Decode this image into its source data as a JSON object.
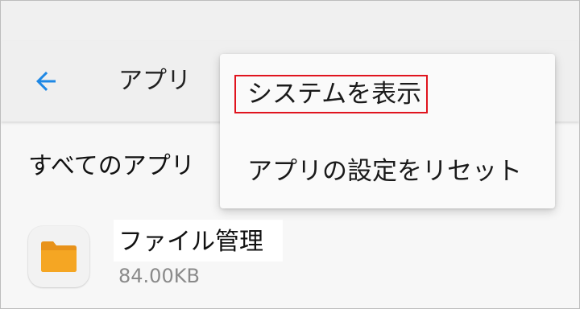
{
  "header": {
    "title": "アプリ",
    "back_icon": "arrow-left-icon",
    "accent_color": "#1e88e5"
  },
  "section": {
    "title": "すべてのアプリ"
  },
  "apps": [
    {
      "name": "ファイル管理",
      "size": "84.00KB",
      "icon": "folder-icon",
      "icon_color": "#f5a623"
    }
  ],
  "menu": {
    "items": [
      {
        "label": "システムを表示",
        "highlighted": true,
        "highlight_color": "#e0141e"
      },
      {
        "label": "アプリの設定をリセット",
        "highlighted": false
      }
    ]
  }
}
